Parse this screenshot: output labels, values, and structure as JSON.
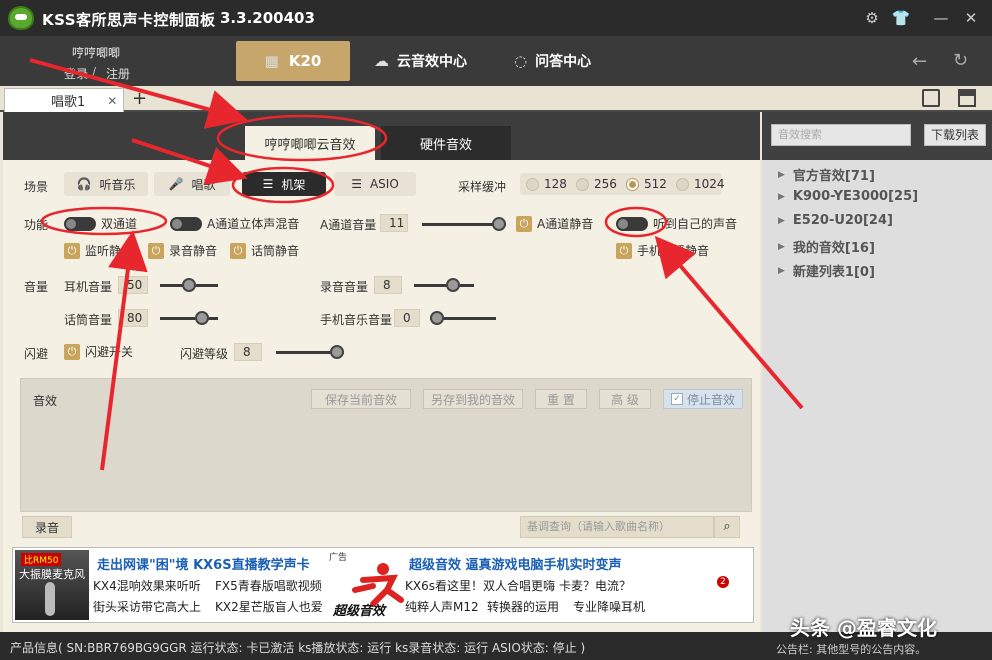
{
  "app": {
    "title": "KSS客所思声卡控制面板",
    "version": "3.3.200403"
  },
  "user": {
    "name": "哼哼唧唧",
    "login": "登录",
    "sep": "/",
    "register": "注册"
  },
  "nav": {
    "k20": "K20",
    "cloud": "云音效中心",
    "qa": "问答中心"
  },
  "doc_tab": {
    "label": "唱歌1",
    "close": "✕",
    "add": "+"
  },
  "subtabs": {
    "cloud": "哼哼唧唧云音效",
    "hardware": "硬件音效"
  },
  "scene": {
    "label": "场景",
    "items": [
      {
        "label": "听音乐",
        "active": false
      },
      {
        "label": "唱歌",
        "active": false
      },
      {
        "label": "机架",
        "active": true
      },
      {
        "label": "ASIO",
        "active": false
      }
    ]
  },
  "sample_buffer": {
    "label": "采样缓冲",
    "options": [
      "128",
      "256",
      "512",
      "1024"
    ],
    "selected": "512"
  },
  "function": {
    "label": "功能",
    "dual_channel": "双通道",
    "a_stereo_mix": "A通道立体声混音",
    "a_volume_label": "A通道音量",
    "a_volume_value": "11",
    "a_volume_level": 100,
    "a_mute": "A通道静音",
    "hear_self": "听到自己的声音",
    "monitor_mute": "监听静音",
    "record_mute": "录音静音",
    "mic_mute": "话筒静音",
    "phone_live_mute": "手机直播静音"
  },
  "volume": {
    "label": "音量",
    "headphone_label": "耳机音量",
    "headphone_value": "50",
    "headphone_level": 50,
    "mic_label": "话筒音量",
    "mic_value": "80",
    "mic_level": 80,
    "record_label": "录音音量",
    "record_value": "8",
    "record_level": 70,
    "phone_music_label": "手机音乐音量",
    "phone_music_value": "0",
    "phone_music_level": 0
  },
  "dodge": {
    "label": "闪避",
    "switch": "闪避开关",
    "level_label": "闪避等级",
    "level_value": "8",
    "level": 100
  },
  "effects": {
    "label": "音效",
    "save_current": "保存当前音效",
    "save_to_mine": "另存到我的音效",
    "reset": "重 置",
    "advanced": "高 级",
    "stop": "停止音效",
    "stop_check": "✓"
  },
  "record": {
    "label": "录音"
  },
  "song_search": {
    "placeholder": "基调查询（请输入歌曲名称）"
  },
  "ad": {
    "img_tag": "比RM50",
    "img_title": "大振膜麦克风",
    "headline1": "走出网课\"困\"境 KX6S直播教学声卡",
    "ad_tag": "广告",
    "headline2": "超级音效  逼真游戏电脑手机实时变声",
    "row1": [
      "KX4混响效果来听听",
      "FX5青春版唱歌视频",
      "KX6s看这里！双人合唱更嗨",
      "卡麦？电流？"
    ],
    "row2": [
      "街头采访带它高大上",
      "KX2星芒版盲人也爱",
      "纯粹人声M12",
      "转换器的运用",
      "专业降噪耳机"
    ],
    "logo_text": "超级音效",
    "badge": "2"
  },
  "right_panel": {
    "search_placeholder": "音效搜索",
    "download": "下载列表",
    "tree": [
      "官方音效[71]",
      "K900-YE3000[25]",
      "E520-U20[24]",
      "我的音效[16]",
      "新建列表1[0]"
    ]
  },
  "status": {
    "text": "产品信息( SN:BBR769BG9GGR  运行状态: 卡已激活  ks播放状态: 运行  ks录音状态: 运行  ASIO状态: 停止 )",
    "notice": "公告栏: 其他型号的公告内容。"
  },
  "watermark": "头条 @盈睿文化",
  "colors": {
    "accent": "#c7a66c",
    "dark": "#2b2b2b",
    "annotation": "#e8262d"
  }
}
